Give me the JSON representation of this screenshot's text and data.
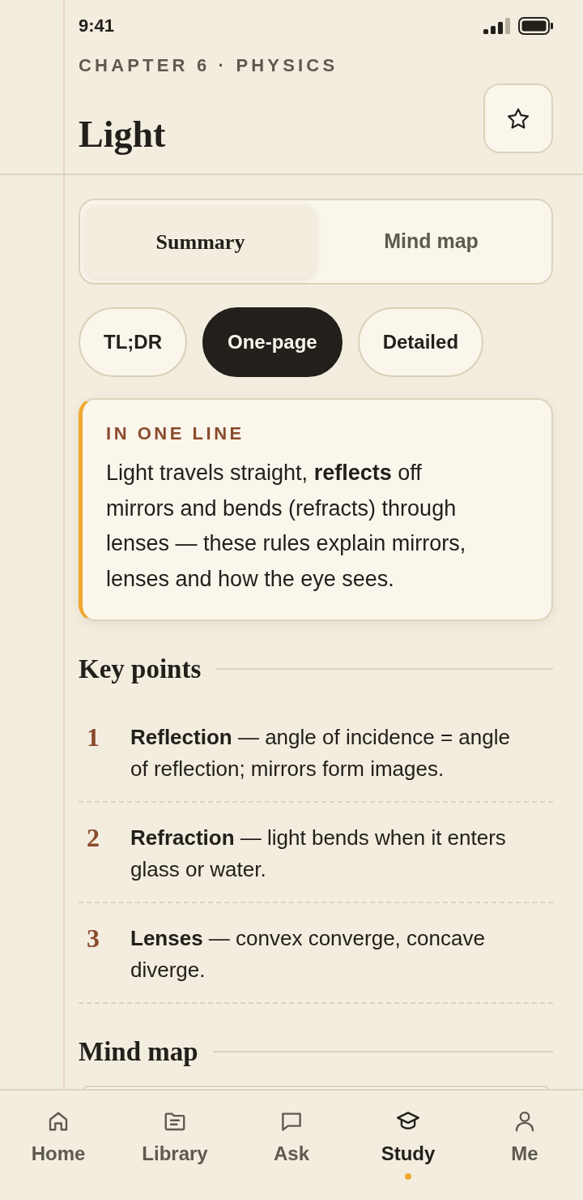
{
  "status_bar": {
    "time": "9:41"
  },
  "header": {
    "eyebrow": "CHAPTER 6 · PHYSICS",
    "title": "Light"
  },
  "view_tabs": [
    {
      "label": "Summary",
      "selected": true
    },
    {
      "label": "Mind map",
      "selected": false
    }
  ],
  "length_options": [
    {
      "label": "TL;DR",
      "selected": false
    },
    {
      "label": "One-page",
      "selected": true
    },
    {
      "label": "Detailed",
      "selected": false
    }
  ],
  "summary_card": {
    "label": "IN ONE LINE",
    "text": "Light travels straight, **reflects** off mirrors and bends (refracts) through lenses — these rules explain mirrors, lenses and how the eye sees."
  },
  "key_points": {
    "heading": "Key points",
    "items": [
      {
        "number": "1",
        "text": "**Reflection** — angle of incidence = angle of reflection; mirrors form images."
      },
      {
        "number": "2",
        "text": "**Refraction** — light bends when it enters glass or water."
      },
      {
        "number": "3",
        "text": "**Lenses** — convex converge, concave diverge."
      }
    ]
  },
  "mind_map": {
    "heading": "Mind map"
  },
  "bottom_nav": [
    {
      "label": "Home",
      "selected": false
    },
    {
      "label": "Library",
      "selected": false
    },
    {
      "label": "Ask",
      "selected": false
    },
    {
      "label": "Study",
      "selected": true
    },
    {
      "label": "Me",
      "selected": false
    }
  ]
}
